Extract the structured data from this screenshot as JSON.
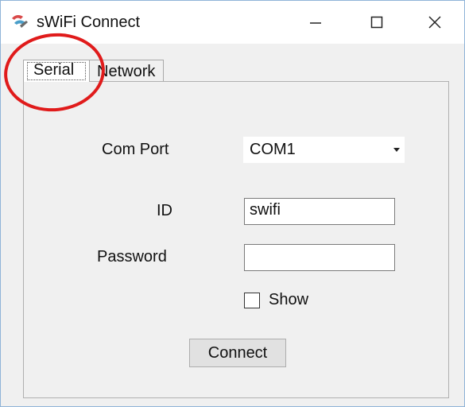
{
  "window": {
    "title": "sWiFi Connect",
    "icon": "swifi-app-icon",
    "controls": {
      "minimize": "minimize-icon",
      "maximize": "maximize-icon",
      "close": "close-icon"
    }
  },
  "tabs": [
    {
      "label": "Serial",
      "selected": true
    },
    {
      "label": "Network",
      "selected": false
    }
  ],
  "form": {
    "com_port_label": "Com Port",
    "com_port_value": "COM1",
    "id_label": "ID",
    "id_value": "swifi",
    "password_label": "Password",
    "password_value": "",
    "show_label": "Show",
    "show_checked": false,
    "connect_label": "Connect"
  },
  "colors": {
    "annotation": "#e01b1b",
    "window_border": "#8fb4d8"
  }
}
